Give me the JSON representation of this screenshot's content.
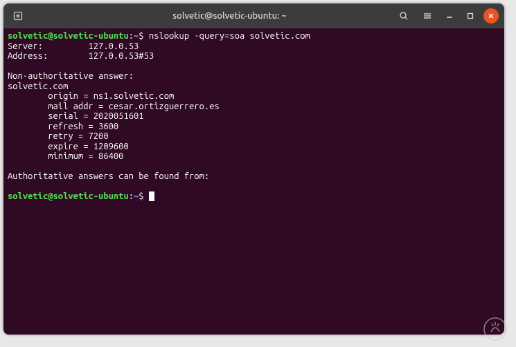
{
  "window": {
    "title": "solvetic@solvetic-ubuntu: ~"
  },
  "prompt": {
    "user_host": "solvetic@solvetic-ubuntu",
    "path": "~",
    "symbol": "$"
  },
  "command": "nslookup -query=soa solvetic.com",
  "output": {
    "server_label": "Server:",
    "server_value": "127.0.0.53",
    "address_label": "Address:",
    "address_value": "127.0.0.53#53",
    "non_auth_header": "Non-authoritative answer:",
    "domain": "solvetic.com",
    "soa": {
      "origin": "origin = ns1.solvetic.com",
      "mail_addr": "mail addr = cesar.ortizguerrero.es",
      "serial": "serial = 2020051601",
      "refresh": "refresh = 3600",
      "retry": "retry = 7200",
      "expire": "expire = 1209600",
      "minimum": "minimum = 86400"
    },
    "auth_footer": "Authoritative answers can be found from:"
  }
}
